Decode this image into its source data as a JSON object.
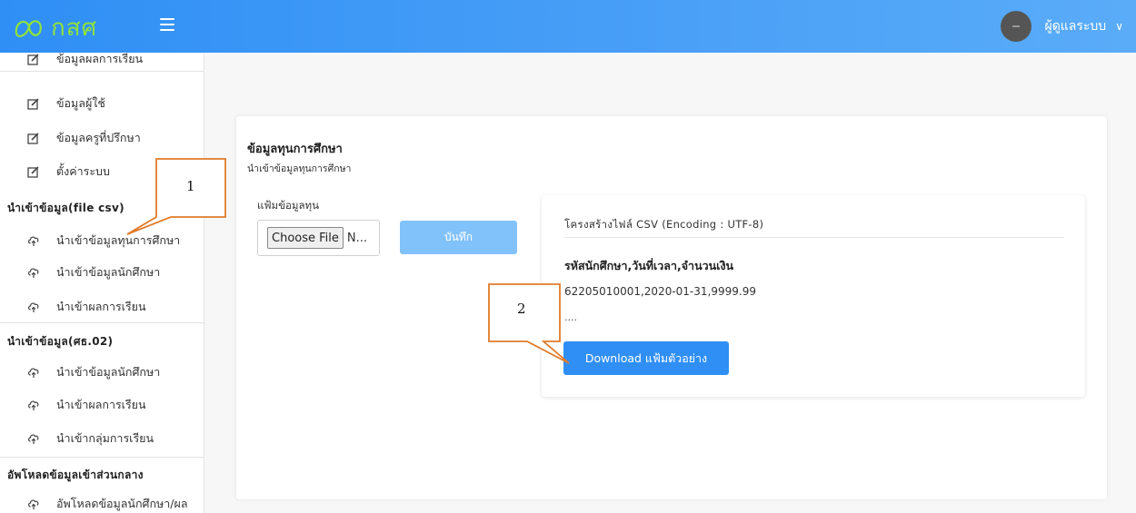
{
  "app": {
    "logo_text": "กสศ"
  },
  "header": {
    "user_name": "ผู้ดูแลระบบ",
    "caret": "∨"
  },
  "sidebar": {
    "items_top": [
      {
        "label": "ข้อมูลผลการเรียน",
        "icon": "edit-icon"
      },
      {
        "label": "ข้อมูลผู้ใช้",
        "icon": "edit-icon"
      },
      {
        "label": "ข้อมูลครูที่ปรึกษา",
        "icon": "edit-icon"
      },
      {
        "label": "ตั้งค่าระบบ",
        "icon": "edit-icon"
      }
    ],
    "section_csv": {
      "title": "นำเข้าข้อมูล(file csv)",
      "items": [
        {
          "label": "นำเข้าข้อมูลทุนการศึกษา",
          "icon": "cloud-upload-icon"
        },
        {
          "label": "นำเข้าข้อมูลนักศึกษา",
          "icon": "cloud-upload-icon"
        },
        {
          "label": "นำเข้าผลการเรียน",
          "icon": "cloud-upload-icon"
        }
      ]
    },
    "section_ss02": {
      "title": "นำเข้าข้อมูล(ศธ.02)",
      "items": [
        {
          "label": "นำเข้าข้อมูลนักศึกษา",
          "icon": "cloud-upload-icon"
        },
        {
          "label": "นำเข้าผลการเรียน",
          "icon": "cloud-upload-icon"
        },
        {
          "label": "นำเข้ากลุ่มการเรียน",
          "icon": "cloud-upload-icon"
        }
      ]
    },
    "section_upload": {
      "title": "อัพโหลดข้อมูลเข้าส่วนกลาง",
      "items": [
        {
          "label": "อัพโหลดข้อมูลนักศึกษา/ผล",
          "icon": "cloud-upload-icon"
        }
      ]
    }
  },
  "main": {
    "title": "ข้อมูลทุนการศึกษา",
    "subtitle": "นำเข้าข้อมูลทุนการศึกษา",
    "file_label": "แฟ้มข้อมูลทุน",
    "file_button": "Choose File",
    "file_name": "N...",
    "save_button": "บันทึก",
    "csv": {
      "title": "โครงสร้างไฟล์ CSV (Encoding : UTF-8)",
      "header_row": "รหัสนักศึกษา,วันที่เวลา,จำนวนเงิน",
      "example_row": "62205010001,2020-01-31,9999.99",
      "ellipsis": "....",
      "download_button": "Download แฟ้มตัวอย่าง"
    }
  },
  "callouts": {
    "one": "1",
    "two": "2"
  },
  "colors": {
    "topbar": "#2f8ff5",
    "save_button": "#82c2fa",
    "download_button": "#2f8ff5",
    "callout_border": "#e07b2a",
    "logo": "#8fe33a"
  }
}
